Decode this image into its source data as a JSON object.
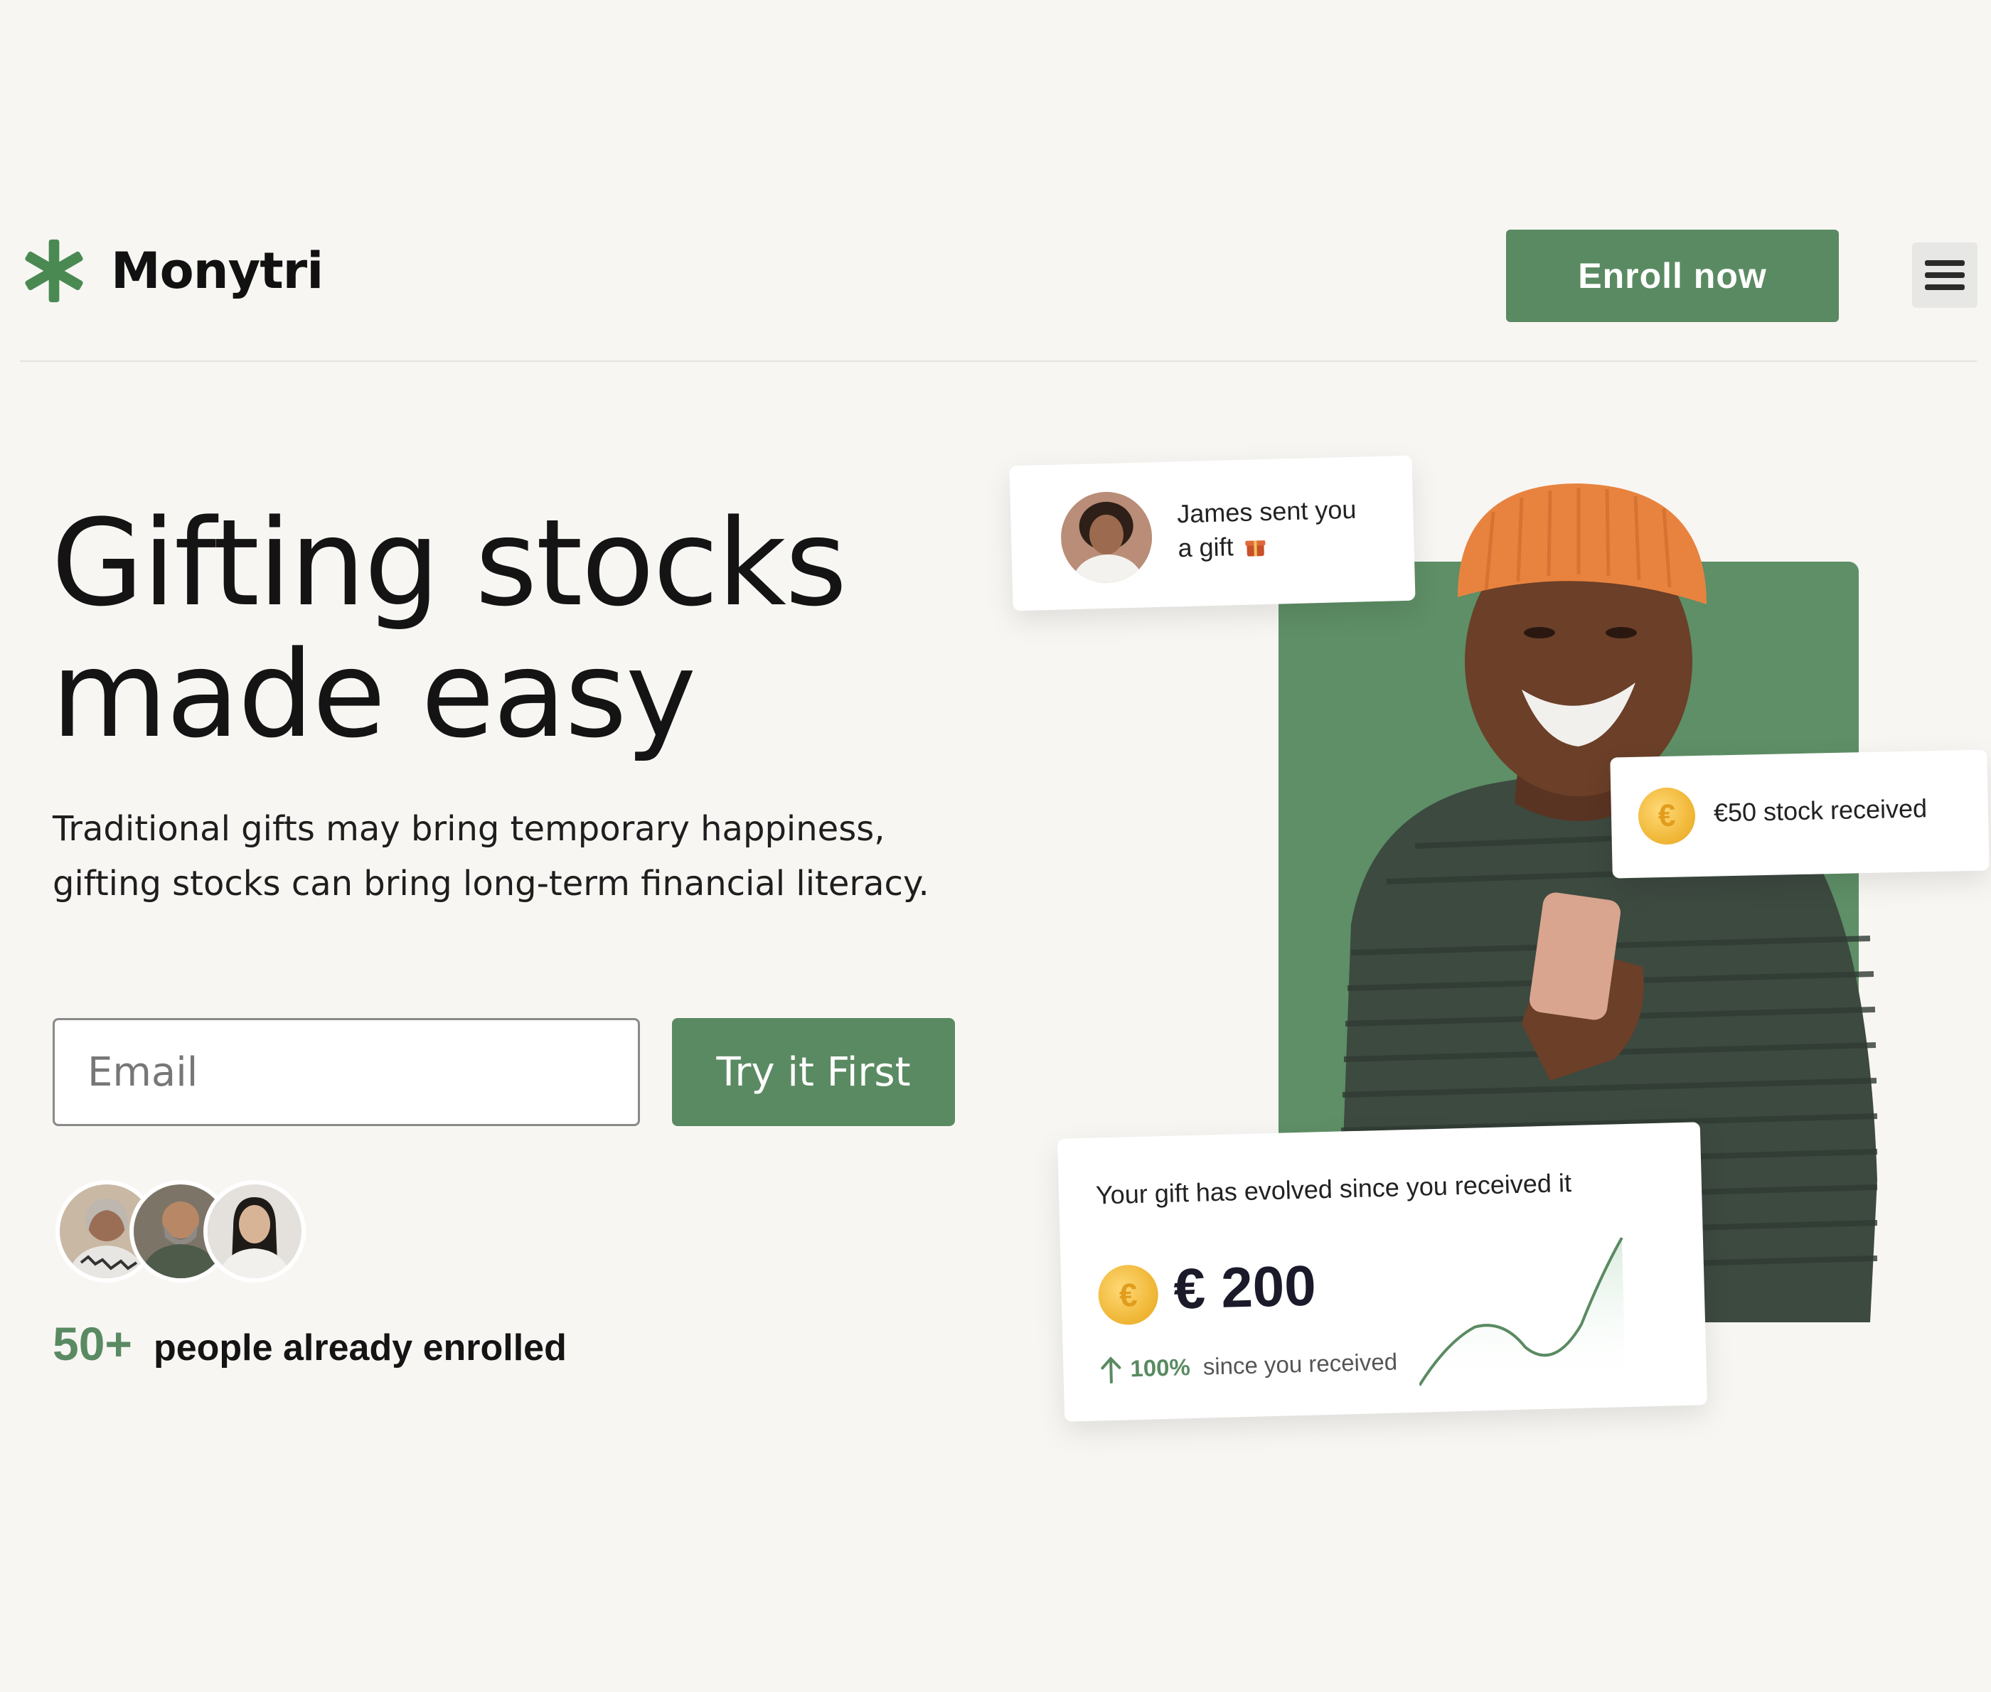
{
  "header": {
    "brand": "Monytri",
    "enroll_label": "Enroll now"
  },
  "hero": {
    "headline_line1": "Gifting stocks",
    "headline_line2": "made easy",
    "subtext": "Traditional gifts may bring temporary happiness, gifting stocks can bring long-term financial literacy.",
    "email_placeholder": "Email",
    "cta_label": "Try it First",
    "enrolled_count": "50+",
    "enrolled_text": "people already enrolled"
  },
  "cards": {
    "gift_line1": "James sent you",
    "gift_line2": "a gift",
    "stock_received": "€50 stock received",
    "evolve_title": "Your gift has evolved since you received it",
    "amount": "€ 200",
    "change_pct": "100%",
    "change_label": "since you received"
  },
  "colors": {
    "brand_green": "#5a8a62",
    "background": "#f8f6f3",
    "coin": "#f1b93a",
    "hat": "#e8833f"
  },
  "icons": [
    "asterisk-logo-icon",
    "hamburger-menu-icon",
    "gift-icon",
    "euro-coin-icon",
    "arrow-up-icon"
  ]
}
